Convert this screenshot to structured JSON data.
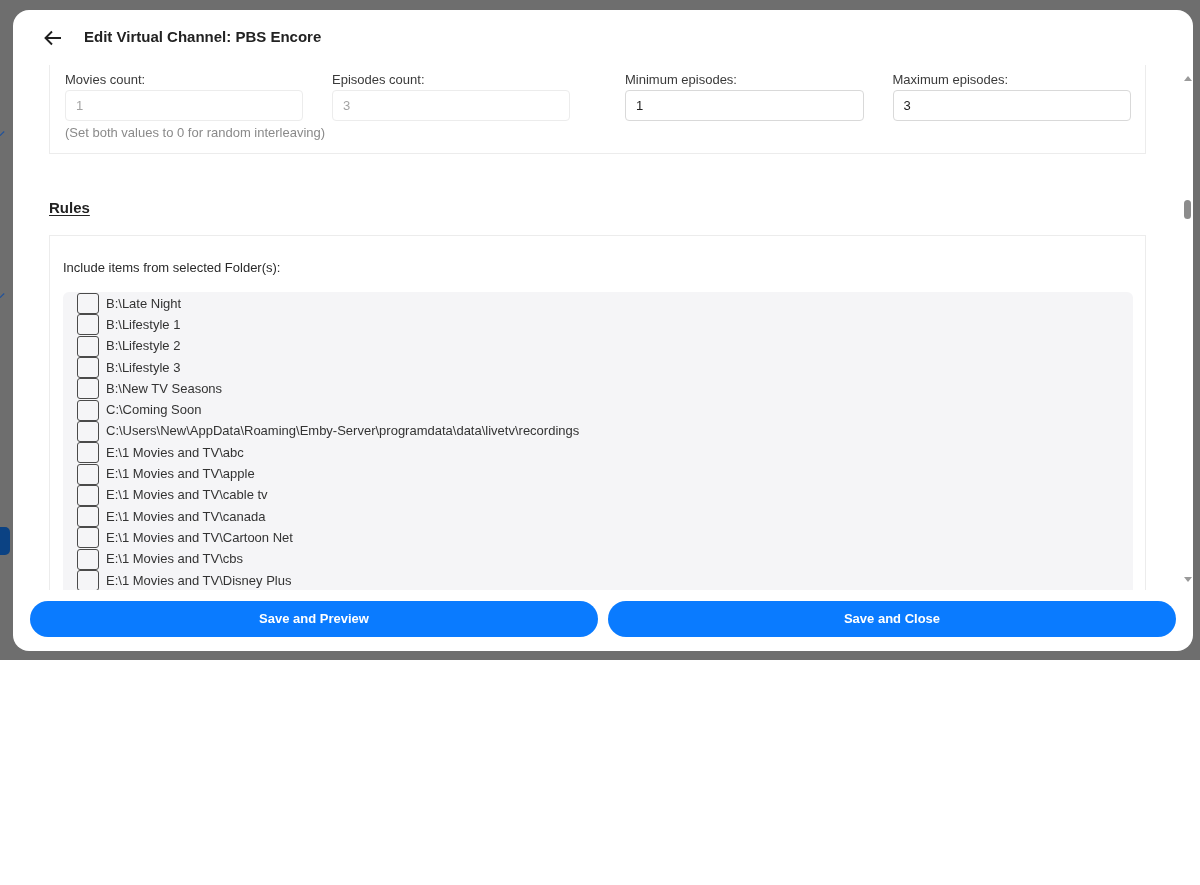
{
  "dialog": {
    "title": "Edit Virtual Channel: PBS Encore"
  },
  "interleave": {
    "fields": [
      {
        "label": "Movies count:",
        "value": "1",
        "disabled": true
      },
      {
        "label": "Episodes count:",
        "value": "3",
        "disabled": true
      }
    ],
    "hint": "(Set both values to 0 for random interleaving)"
  },
  "episodes_range": {
    "fields": [
      {
        "label": "Minimum episodes:",
        "value": "1",
        "disabled": false
      },
      {
        "label": "Maximum episodes:",
        "value": "3",
        "disabled": false
      }
    ]
  },
  "rules": {
    "heading": "Rules",
    "folders_label": "Include items from selected Folder(s):",
    "folders": [
      {
        "label": "B:\\Late Night",
        "checked": false
      },
      {
        "label": "B:\\Lifestyle 1",
        "checked": false
      },
      {
        "label": "B:\\Lifestyle 2",
        "checked": false
      },
      {
        "label": "B:\\Lifestyle 3",
        "checked": false
      },
      {
        "label": "B:\\New TV Seasons",
        "checked": false
      },
      {
        "label": "C:\\Coming Soon",
        "checked": false
      },
      {
        "label": "C:\\Users\\New\\AppData\\Roaming\\Emby-Server\\programdata\\data\\livetv\\recordings",
        "checked": false
      },
      {
        "label": "E:\\1 Movies and TV\\abc",
        "checked": false
      },
      {
        "label": "E:\\1 Movies and TV\\apple",
        "checked": false
      },
      {
        "label": "E:\\1 Movies and TV\\cable tv",
        "checked": false
      },
      {
        "label": "E:\\1 Movies and TV\\canada",
        "checked": false
      },
      {
        "label": "E:\\1 Movies and TV\\Cartoon Net",
        "checked": false
      },
      {
        "label": "E:\\1 Movies and TV\\cbs",
        "checked": false
      },
      {
        "label": "E:\\1 Movies and TV\\Disney Plus",
        "checked": false
      }
    ]
  },
  "buttons": [
    {
      "label": "Save and Preview"
    },
    {
      "label": "Save and Close"
    }
  ]
}
